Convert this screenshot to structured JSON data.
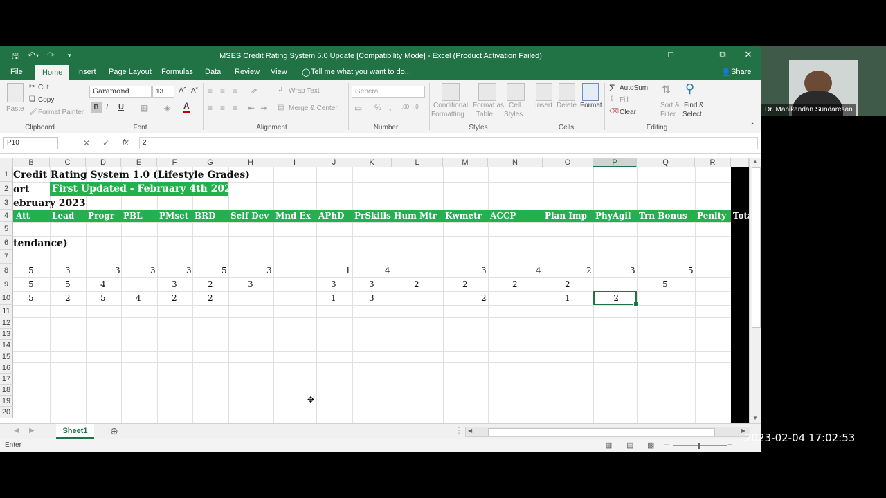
{
  "window": {
    "title": "MSES Credit Rating System 5.0 Update  [Compatibility Mode] - Excel (Product Activation Failed)"
  },
  "ribbon_tabs": [
    "File",
    "Home",
    "Insert",
    "Page Layout",
    "Formulas",
    "Data",
    "Review",
    "View"
  ],
  "tell_me": "Tell me what you want to do...",
  "share": "Share",
  "clipboard": {
    "paste": "Paste",
    "cut": "Cut",
    "copy": "Copy",
    "format_painter": "Format Painter",
    "label": "Clipboard"
  },
  "font": {
    "name": "Garamond",
    "size": "13",
    "bold": "B",
    "italic": "I",
    "underline": "U",
    "label": "Font"
  },
  "alignment": {
    "wrap": "Wrap Text",
    "merge": "Merge & Center",
    "label": "Alignment"
  },
  "number": {
    "format": "General",
    "percent": "%",
    "comma": ",",
    "label": "Number"
  },
  "styles": {
    "conditional": [
      "Conditional",
      "Formatting"
    ],
    "format_table": [
      "Format as",
      "Table"
    ],
    "cell_styles": [
      "Cell",
      "Styles"
    ],
    "label": "Styles"
  },
  "cells_group": {
    "insert": "Insert",
    "delete": "Delete",
    "format": "Format",
    "label": "Cells"
  },
  "editing": {
    "autosum": "AutoSum",
    "fill": "Fill",
    "clear": "Clear",
    "sort": [
      "Sort &",
      "Filter"
    ],
    "find": [
      "Find &",
      "Select"
    ],
    "label": "Editing"
  },
  "formula_bar": {
    "name_box": "P10",
    "fx": "fx",
    "value": "2"
  },
  "columns": [
    "B",
    "C",
    "D",
    "E",
    "F",
    "G",
    "H",
    "I",
    "J",
    "K",
    "L",
    "M",
    "N",
    "O",
    "P",
    "Q",
    "R"
  ],
  "selected_column": "P",
  "rows": [
    "1",
    "2",
    "3",
    "4",
    "5",
    "6",
    "7",
    "8",
    "9",
    "10",
    "11",
    "12",
    "13",
    "14",
    "15",
    "16",
    "17",
    "18",
    "19",
    "20"
  ],
  "sheet": {
    "r1": "Credit Rating System 1.0 (Lifestyle Grades)",
    "r2a": "ort",
    "r2b": "First Updated - February 4th 2023",
    "r3": "ebruary 2023",
    "headers": [
      "Att",
      "Lead",
      "Progr",
      "PBL",
      "PMset",
      "BRD",
      "Self Dev",
      "Mnd Ex",
      "APhD",
      "PrSkills",
      "Hum Mtr",
      "Kwmetr",
      "ACCP",
      "Plan Imp",
      "PhyAgil",
      "Trn Bonus",
      "Penlty",
      "Tota"
    ],
    "r6": "tendance)",
    "row8": [
      "5",
      "3",
      "3",
      "3",
      "3",
      "5",
      "3",
      "1",
      "4",
      "3",
      "4",
      "2",
      "3",
      "5"
    ],
    "row9": [
      "5",
      "5",
      "4",
      "3",
      "2",
      "3",
      "3",
      "3",
      "2",
      "2",
      "2",
      "2",
      "5"
    ],
    "row10": [
      "5",
      "2",
      "5",
      "4",
      "2",
      "2",
      "1",
      "3",
      "2",
      "1",
      "2"
    ]
  },
  "sheet_tab": "Sheet1",
  "status": "Enter",
  "webcam_name": "Dr. Manikandan Sundaresan",
  "timestamp": "2023-02-04 17:02:53",
  "colors": {
    "excel_green": "#217346",
    "header_fill": "#22b14c"
  }
}
